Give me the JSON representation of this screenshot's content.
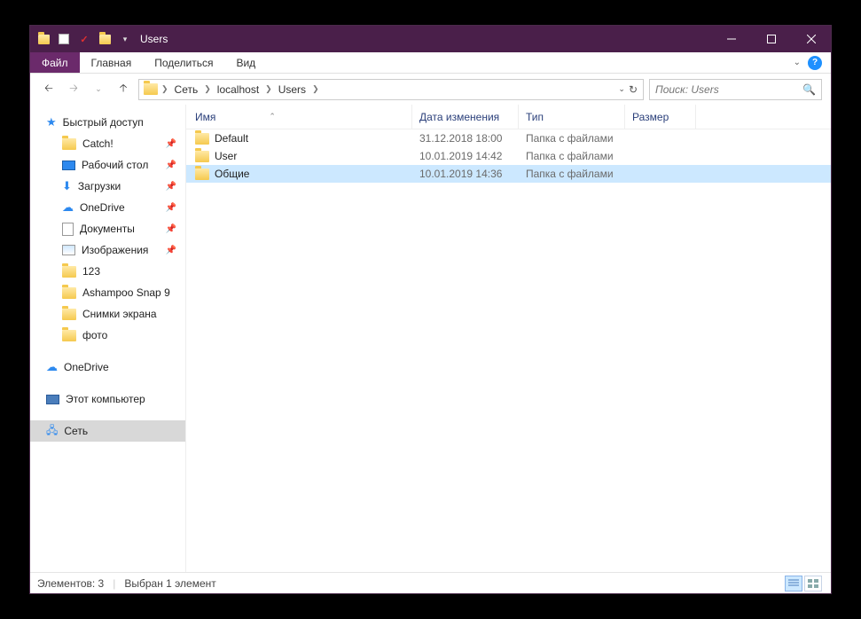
{
  "titlebar": {
    "title": "Users"
  },
  "ribbon": {
    "file": "Файл",
    "tabs": [
      "Главная",
      "Поделиться",
      "Вид"
    ]
  },
  "breadcrumbs": [
    "Сеть",
    "localhost",
    "Users"
  ],
  "search": {
    "placeholder": "Поиск: Users"
  },
  "sidebar": {
    "quick": {
      "label": "Быстрый доступ"
    },
    "quick_items": [
      {
        "label": "Catch!",
        "icon": "folder",
        "pinned": true
      },
      {
        "label": "Рабочий стол",
        "icon": "desktop",
        "pinned": true
      },
      {
        "label": "Загрузки",
        "icon": "downloads",
        "pinned": true
      },
      {
        "label": "OneDrive",
        "icon": "onedrive",
        "pinned": true
      },
      {
        "label": "Документы",
        "icon": "doc",
        "pinned": true
      },
      {
        "label": "Изображения",
        "icon": "img",
        "pinned": true
      },
      {
        "label": "123",
        "icon": "folder",
        "pinned": false
      },
      {
        "label": "Ashampoo Snap 9",
        "icon": "folder",
        "pinned": false
      },
      {
        "label": "Снимки экрана",
        "icon": "folder",
        "pinned": false
      },
      {
        "label": "фото",
        "icon": "folder",
        "pinned": false
      }
    ],
    "onedrive": {
      "label": "OneDrive"
    },
    "thispc": {
      "label": "Этот компьютер"
    },
    "network": {
      "label": "Сеть"
    }
  },
  "columns": {
    "name": "Имя",
    "date": "Дата изменения",
    "type": "Тип",
    "size": "Размер"
  },
  "rows": [
    {
      "name": "Default",
      "date": "31.12.2018 18:00",
      "type": "Папка с файлами",
      "selected": false
    },
    {
      "name": "User",
      "date": "10.01.2019 14:42",
      "type": "Папка с файлами",
      "selected": false
    },
    {
      "name": "Общие",
      "date": "10.01.2019 14:36",
      "type": "Папка с файлами",
      "selected": true
    }
  ],
  "status": {
    "count": "Элементов: 3",
    "selected": "Выбран 1 элемент"
  }
}
